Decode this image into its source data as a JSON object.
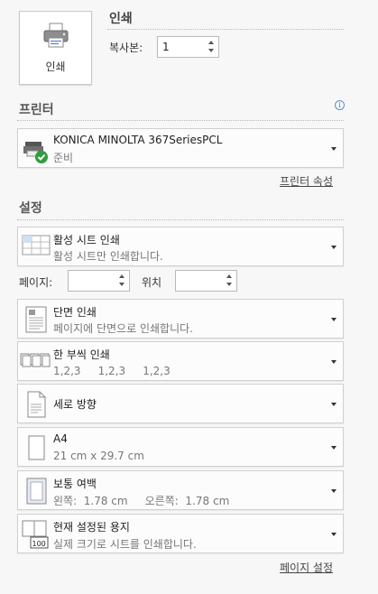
{
  "print": {
    "button_label": "인쇄",
    "heading": "인쇄",
    "copies_label": "복사본:",
    "copies_value": "1"
  },
  "printer": {
    "heading": "프린터",
    "name": "KONICA MINOLTA 367SeriesPCL",
    "status": "준비",
    "properties_link": "프린터 속성"
  },
  "settings": {
    "heading": "설정",
    "print_what": {
      "title": "활성 시트 인쇄",
      "desc": "활성 시트만 인쇄합니다."
    },
    "pages_label": "페이지:",
    "pages_value": "",
    "to_label": "위치",
    "to_value": "",
    "sides": {
      "title": "단면 인쇄",
      "desc": "페이지에 단면으로 인쇄합니다."
    },
    "collation": {
      "title": "한 부씩 인쇄",
      "desc": "1,2,3     1,2,3     1,2,3"
    },
    "orientation": {
      "title": "세로 방향"
    },
    "paper": {
      "title": "A4",
      "desc": "21 cm x 29.7 cm"
    },
    "margins": {
      "title": "보통 여백",
      "desc": "왼쪽:  1.78 cm     오른쪽:  1.78 cm"
    },
    "scaling": {
      "title": "현재 설정된 용지",
      "desc": "실제 크기로 시트를 인쇄합니다.",
      "icon_text": "100"
    },
    "page_setup_link": "페이지 설정"
  },
  "icons": {
    "info": "i",
    "status_check_color": "#2e9e3e",
    "accent": "#3a78c4"
  }
}
